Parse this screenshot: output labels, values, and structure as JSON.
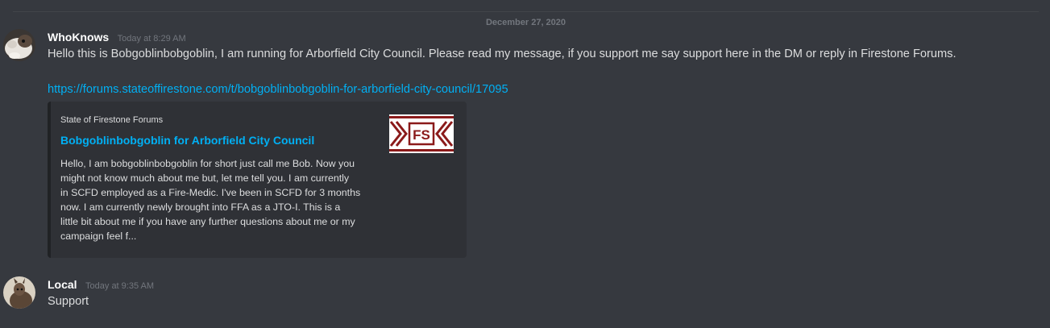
{
  "divider": {
    "date": "December 27, 2020"
  },
  "messages": [
    {
      "username": "WhoKnows",
      "timestamp": "Today at 8:29 AM",
      "text": "Hello this is Bobgoblinbobgoblin, I am running for Arborfield City Council. Please read my message, if you support me say support here in the DM or reply in Firestone Forums.",
      "link": "https://forums.stateoffirestone.com/t/bobgoblinbobgoblin-for-arborfield-city-council/17095",
      "embed": {
        "provider": "State of Firestone Forums",
        "title": "Bobgoblinbobgoblin for Arborfield City Council",
        "description_lines": [
          "Hello, I am bobgoblinbobgoblin for short just call me Bob. Now you",
          "might not know much about me but, let me tell you. I am currently",
          "in SCFD employed as a Fire-Medic. I've been in SCFD for 3 months",
          "now. I am currently newly brought into FFA as a JTO-I. This is a",
          "little bit about me if you have any further questions about me or my",
          "campaign feel f..."
        ],
        "thumbnail_text": "FS",
        "thumbnail_color": "#8b1a1a"
      }
    },
    {
      "username": "Local",
      "timestamp": "Today at 9:35 AM",
      "text": "Support"
    }
  ]
}
